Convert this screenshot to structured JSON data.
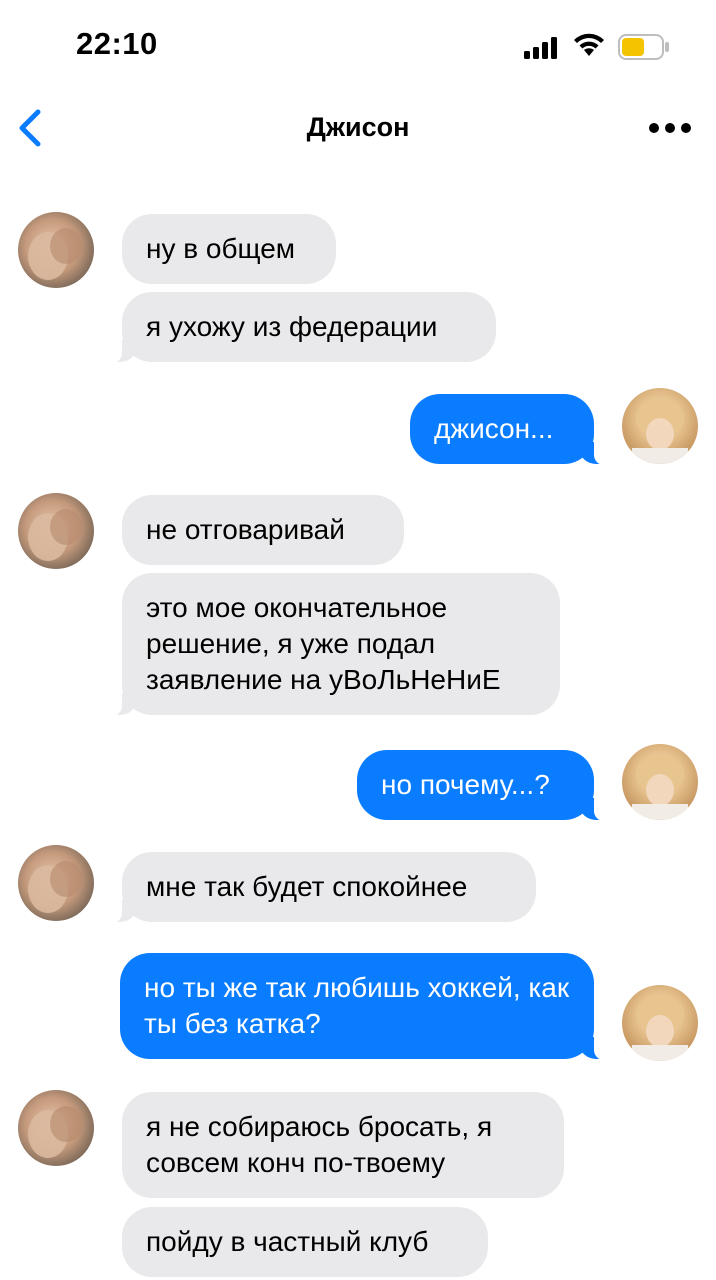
{
  "status_bar": {
    "time": "22:10",
    "battery_color": "#f5c400"
  },
  "header": {
    "title": "Джисон",
    "back_icon": "chevron-left-icon",
    "more_icon": "ellipsis-icon"
  },
  "colors": {
    "accent": "#0a7cff",
    "incoming_bubble": "#e9e9eb"
  },
  "messages": [
    {
      "from": "Джисон",
      "text": "ну в общем"
    },
    {
      "from": "Джисон",
      "text": "я ухожу из федерации"
    },
    {
      "from": "me",
      "text": "джисон..."
    },
    {
      "from": "Джисон",
      "text": "не отговаривай"
    },
    {
      "from": "Джисон",
      "text": "это мое окончательное решение, я уже подал заявление на уВоЛьНеНиЕ"
    },
    {
      "from": "me",
      "text": "но почему...?"
    },
    {
      "from": "Джисон",
      "text": "мне так будет спокойнее"
    },
    {
      "from": "me",
      "text": "но ты же так любишь хоккей, как ты без катка?"
    },
    {
      "from": "Джисон",
      "text": "я не собираюсь бросать, я совсем конч по-твоему"
    },
    {
      "from": "Джисон",
      "text": "пойду в частный клуб"
    }
  ]
}
